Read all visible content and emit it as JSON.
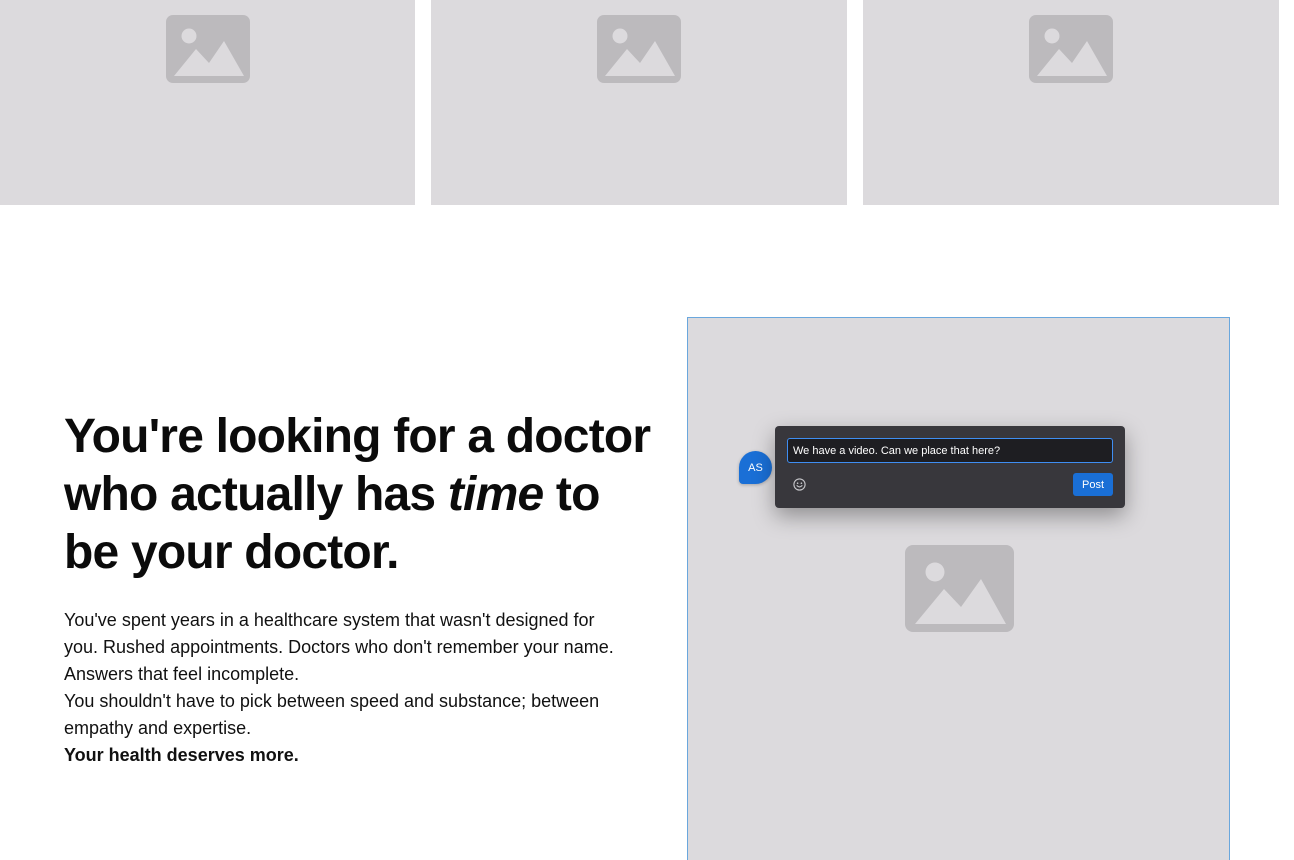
{
  "gallery": {
    "images": [
      {
        "icon": "image-placeholder-icon"
      },
      {
        "icon": "image-placeholder-icon"
      },
      {
        "icon": "image-placeholder-icon"
      }
    ]
  },
  "hero": {
    "headline_part1": "You're looking for a doctor who actually has ",
    "headline_emphasis": "time",
    "headline_part2": " to be your doctor.",
    "paragraph1": "You've spent years in a healthcare system that wasn't designed for you. Rushed appointments. Doctors who don't remember your name. Answers that feel incomplete.",
    "paragraph2": "You shouldn't have to pick between speed and substance; between empathy and expertise.",
    "paragraph3": "Your health deserves more."
  },
  "media": {
    "icon": "image-placeholder-icon",
    "border_color": "#6aa7dd",
    "background_color": "#dcdadd"
  },
  "comment": {
    "avatar_initials": "AS",
    "input_value": "We have a video. Can we place that here?",
    "emoji_icon": "smiley-icon",
    "post_label": "Post",
    "accent_color": "#1a6fd6"
  }
}
